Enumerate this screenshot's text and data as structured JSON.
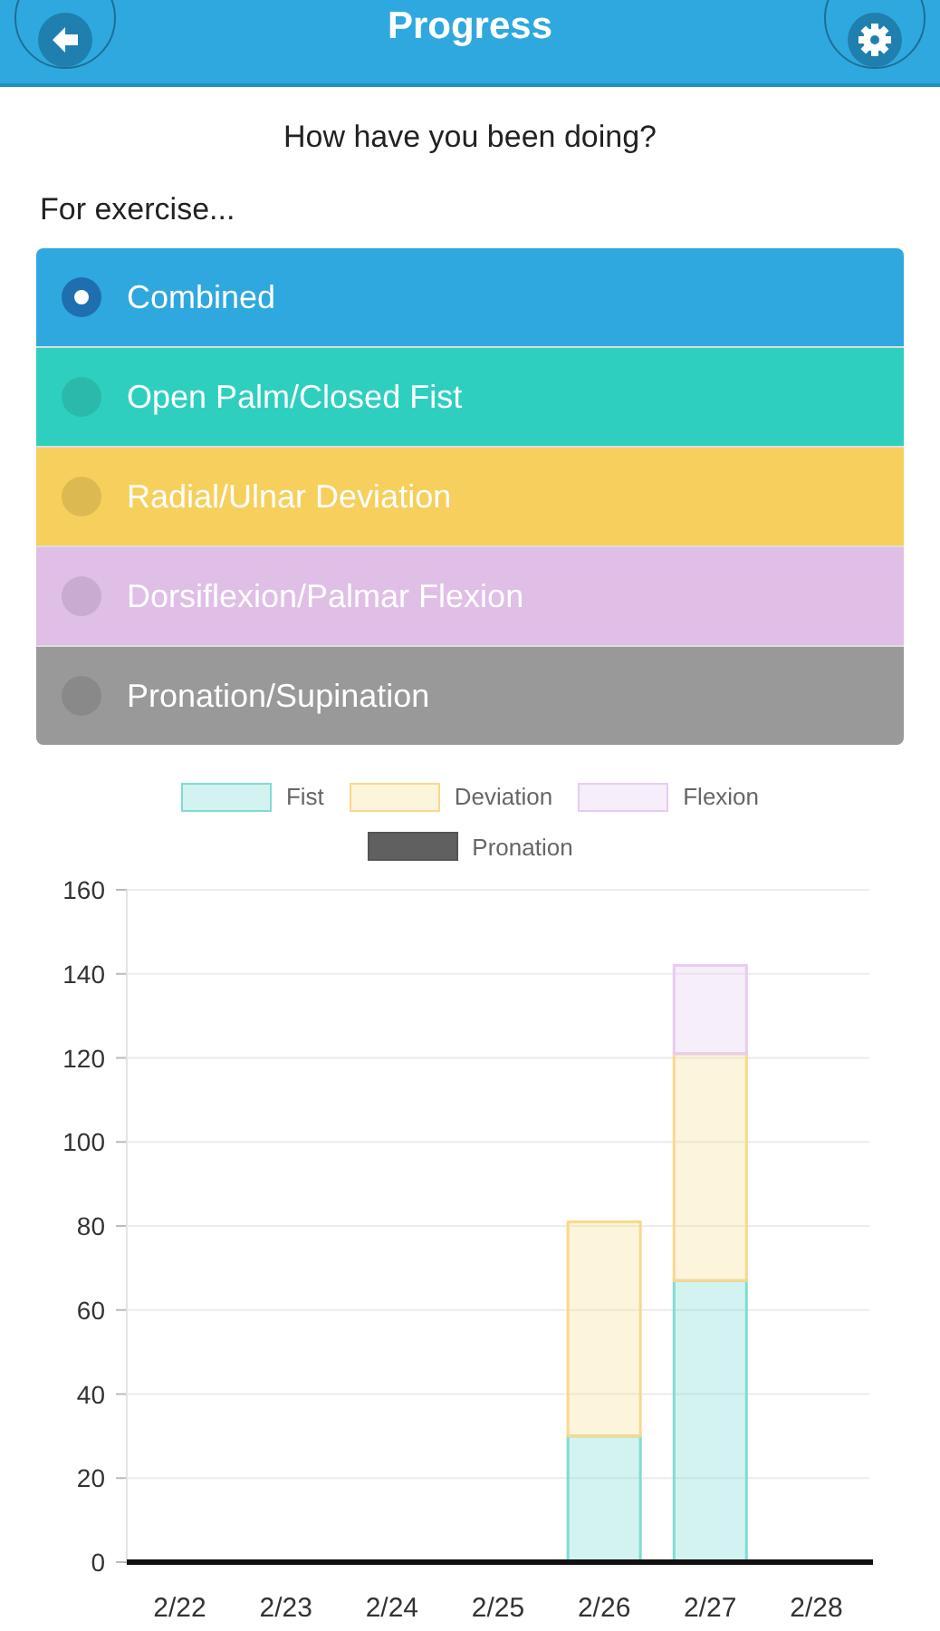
{
  "header": {
    "title": "Progress"
  },
  "question": "How have you been doing?",
  "exercise_label": "For exercise...",
  "exercises": [
    {
      "label": "Combined",
      "selected": true,
      "color": "#2fa8df"
    },
    {
      "label": "Open Palm/Closed Fist",
      "selected": false,
      "color": "#2fcfbf"
    },
    {
      "label": "Radial/Ulnar Deviation",
      "selected": false,
      "color": "#f7cf5c"
    },
    {
      "label": "Dorsiflexion/Palmar Flexion",
      "selected": false,
      "color": "#dfbfe6"
    },
    {
      "label": "Pronation/Supination",
      "selected": false,
      "color": "#999999"
    }
  ],
  "chart": {
    "chart_data": {
      "type": "bar",
      "stacked": true,
      "grid": true,
      "categories": [
        "2/22",
        "2/23",
        "2/24",
        "2/25",
        "2/26",
        "2/27",
        "2/28"
      ],
      "ylim": [
        0,
        160
      ],
      "yticks": [
        0,
        20,
        40,
        60,
        80,
        100,
        120,
        140,
        160
      ],
      "series": [
        {
          "name": "Fist",
          "color": "#7fdcd3",
          "values": [
            0,
            0,
            0,
            0,
            30,
            67,
            0
          ]
        },
        {
          "name": "Deviation",
          "color": "#f7d98a",
          "values": [
            0,
            0,
            0,
            0,
            51,
            54,
            0
          ]
        },
        {
          "name": "Flexion",
          "color": "#e6cdee",
          "values": [
            0,
            0,
            0,
            0,
            0,
            21,
            0
          ]
        },
        {
          "name": "Pronation",
          "color": "#555555",
          "values": [
            0,
            0,
            0,
            0,
            0,
            0,
            0
          ]
        }
      ]
    }
  }
}
